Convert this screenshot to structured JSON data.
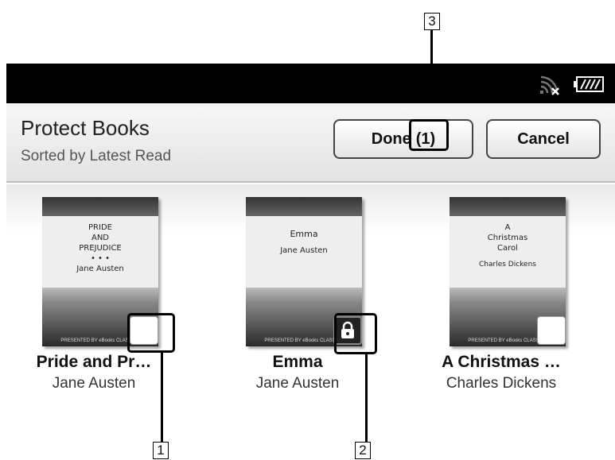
{
  "header": {
    "title": "Protect Books",
    "subtitle": "Sorted by Latest Read"
  },
  "buttons": {
    "done_label": "Done",
    "done_count": "(1)",
    "cancel_label": "Cancel"
  },
  "status_icons": [
    "wireless-off-icon",
    "battery-icon"
  ],
  "books": [
    {
      "title": "Pride and Pr…",
      "author": "Jane Austen",
      "cover_lines": [
        "PRIDE",
        "AND",
        "PREJUDICE",
        "• • •",
        "Jane Austen"
      ],
      "cover_footer": "PRESENTED BY eBooks CLASSICS",
      "protected": false
    },
    {
      "title": "Emma",
      "author": "Jane Austen",
      "cover_lines": [
        "Emma",
        "Jane Austen"
      ],
      "cover_footer": "PRESENTED BY eBooks CLASSICS",
      "protected": true
    },
    {
      "title": "A Christmas …",
      "author": "Charles Dickens",
      "cover_lines": [
        "A",
        "Christmas",
        "Carol",
        "Charles Dickens"
      ],
      "cover_footer": "PRESENTED BY eBooks CLASSICS",
      "protected": false
    }
  ],
  "callouts": [
    "1",
    "2",
    "3"
  ]
}
